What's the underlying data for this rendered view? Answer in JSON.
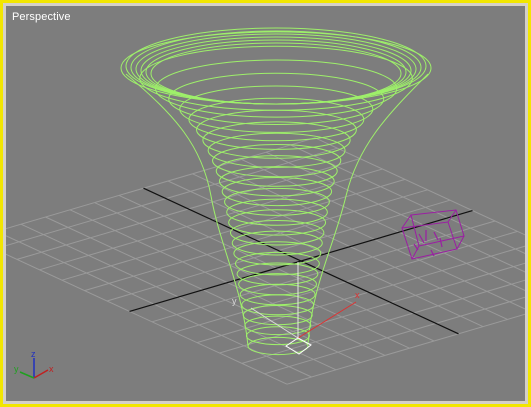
{
  "viewport": {
    "label": "Perspective",
    "active_border_color": "#f2e600",
    "background_color": "#7d7d7d"
  },
  "scene": {
    "spiral_color": "#9ef06a",
    "box_color": "#9b1fa3",
    "grid_color": "#9a9a9a",
    "grid_axis_color": "#111111",
    "gizmo_x_color": "#e03030",
    "gizmo_y_color": "#d8d8d8",
    "gizmo_z_color": "#e8e8e8",
    "pivot_color": "#ffffff"
  },
  "axis_tripod": {
    "x_label": "x",
    "y_label": "y",
    "z_label": "z",
    "x_color": "#c02020",
    "y_color": "#20a020",
    "z_color": "#2030c0"
  },
  "gizmo": {
    "x_label": "x",
    "y_label": "y"
  }
}
